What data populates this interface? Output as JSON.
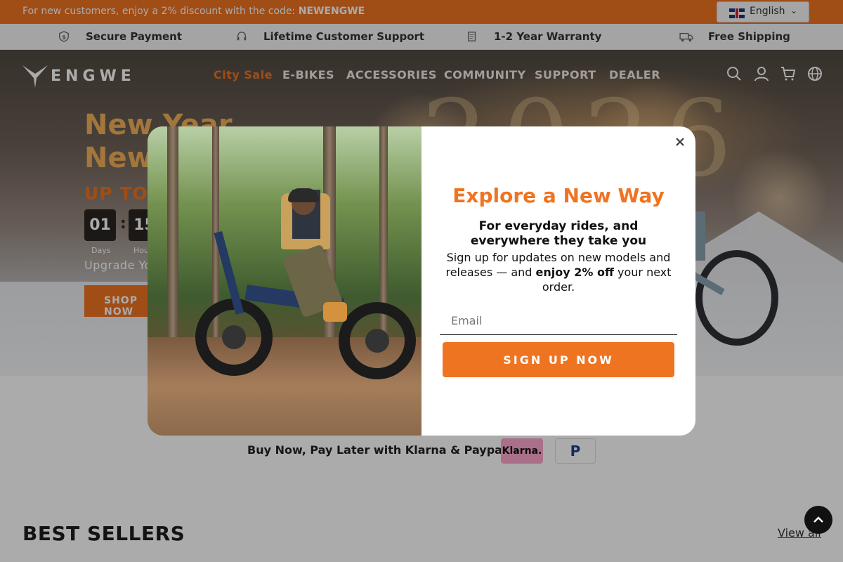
{
  "announcement": {
    "text": "For new customers, enjoy a 2% discount with the code:",
    "code": "NEWENGWE"
  },
  "language": {
    "label": "English",
    "flag": "uk-flag-icon",
    "chevron": "⌄"
  },
  "features": [
    {
      "icon": "shield-dollar-icon",
      "label": "Secure Payment"
    },
    {
      "icon": "headset-icon",
      "label": "Lifetime Customer Support"
    },
    {
      "icon": "warranty-doc-icon",
      "label": "1-2 Year Warranty"
    },
    {
      "icon": "truck-icon",
      "label": "Free Shipping"
    }
  ],
  "header": {
    "logo": "ENGWE",
    "nav": [
      "City Sale",
      "E-BIKES",
      "ACCESSORIES",
      "COMMUNITY",
      "SUPPORT",
      "DEALER"
    ],
    "icons": [
      "search-icon",
      "account-icon",
      "cart-icon",
      "globe-icon"
    ]
  },
  "hero": {
    "line1": "New Year",
    "line2": "New",
    "upto": "UP TO $",
    "countdown": [
      {
        "value": "01",
        "label": "Days"
      },
      {
        "value": "15",
        "label": "Hou"
      }
    ],
    "colon": ":",
    "upgrade": "Upgrade Yo",
    "shop": "SHOP NOW",
    "year_art": "2026"
  },
  "popup": {
    "title": "Explore a New Way",
    "subtitle": "For everyday rides, and everywhere they take you",
    "body_pre": "Sign up for updates on new models and releases — and ",
    "body_bold": "enjoy 2% off",
    "body_post": " your next order.",
    "email_placeholder": "Email",
    "button": "SIGN UP NOW",
    "close_icon": "close-icon"
  },
  "payment": {
    "text": "Buy Now, Pay Later with Klarna & Paypal",
    "klarna": "Klarna.",
    "paypal": "P"
  },
  "best_sellers": {
    "title": "BEST SELLERS",
    "view_all": "View all"
  },
  "colors": {
    "accent": "#ef7422",
    "overlay": "rgba(0,0,0,0.33)",
    "klarna": "#ffa8cd",
    "paypal": "#1c3f94"
  }
}
